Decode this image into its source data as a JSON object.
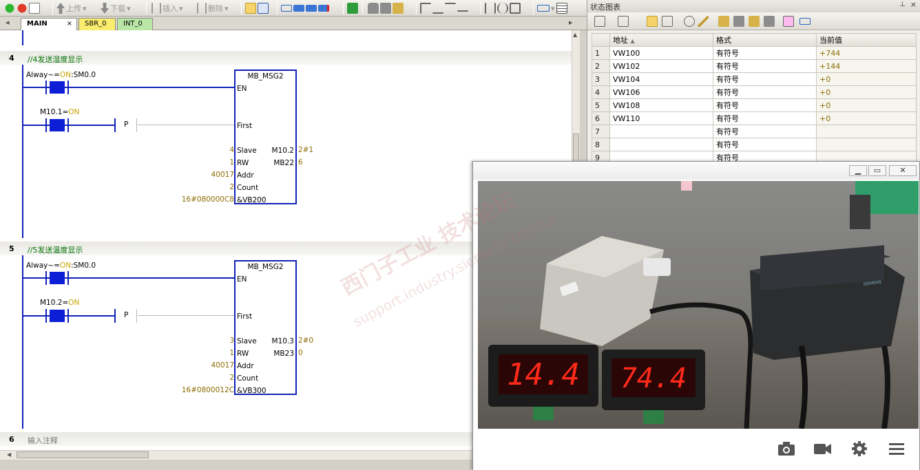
{
  "toolbar": {
    "upload_label": "上传",
    "download_label": "下载",
    "insert_label": "插入",
    "delete_label": "删除"
  },
  "tabs": [
    {
      "label": "MAIN"
    },
    {
      "label": "SBR_0"
    },
    {
      "label": "INT_0"
    }
  ],
  "networks": [
    {
      "number": "4",
      "comment": "//4发送湿度显示",
      "contact1": {
        "name": "Alway~",
        "state": "ON",
        "addr": ":SM0.0"
      },
      "contact2": {
        "name": "M10.1",
        "state": "ON"
      },
      "edge": "P",
      "block": {
        "title": "MB_MSG2",
        "pins_left": [
          "EN",
          "First",
          "Slave",
          "RW",
          "Addr",
          "Count",
          "&VB200"
        ],
        "inputs": [
          "4",
          "1",
          "40017",
          "2",
          "16#080000C8"
        ],
        "outputs": [
          {
            "name": "M10.2",
            "value": "2#1"
          },
          {
            "name": "MB22",
            "value": "6"
          }
        ]
      }
    },
    {
      "number": "5",
      "comment": "//5发送温度显示",
      "contact1": {
        "name": "Alway~",
        "state": "ON",
        "addr": ":SM0.0"
      },
      "contact2": {
        "name": "M10.2",
        "state": "ON"
      },
      "edge": "P",
      "block": {
        "title": "MB_MSG2",
        "pins_left": [
          "EN",
          "First",
          "Slave",
          "RW",
          "Addr",
          "Count",
          "&VB300"
        ],
        "inputs": [
          "3",
          "1",
          "40017",
          "2",
          "16#0800012C"
        ],
        "outputs": [
          {
            "name": "M10.3",
            "value": "2#0"
          },
          {
            "name": "MB23",
            "value": "0"
          }
        ]
      }
    },
    {
      "number": "6",
      "comment": "输入注释"
    }
  ],
  "status_chart": {
    "title": "状态图表",
    "headers": [
      "地址",
      "格式",
      "当前值"
    ],
    "rows": [
      {
        "n": "1",
        "addr": "VW100",
        "fmt": "有符号",
        "cur": "+744"
      },
      {
        "n": "2",
        "addr": "VW102",
        "fmt": "有符号",
        "cur": "+144"
      },
      {
        "n": "3",
        "addr": "VW104",
        "fmt": "有符号",
        "cur": "+0"
      },
      {
        "n": "4",
        "addr": "VW106",
        "fmt": "有符号",
        "cur": "+0"
      },
      {
        "n": "5",
        "addr": "VW108",
        "fmt": "有符号",
        "cur": "+0"
      },
      {
        "n": "6",
        "addr": "VW110",
        "fmt": "有符号",
        "cur": "+0"
      },
      {
        "n": "7",
        "addr": "",
        "fmt": "有符号",
        "cur": ""
      },
      {
        "n": "8",
        "addr": "",
        "fmt": "有符号",
        "cur": ""
      },
      {
        "n": "9",
        "addr": "",
        "fmt": "有符号",
        "cur": ""
      }
    ]
  },
  "video": {
    "display_left": "14.4",
    "display_right": "74.4",
    "brand": "SIEMENS",
    "icons": [
      "camera-icon",
      "video-icon",
      "gear-icon",
      "menu-icon"
    ]
  },
  "watermark": {
    "line1": "西门子工业  技术论坛",
    "line2": "support.industry.siemens.com/cs"
  },
  "colors": {
    "wire": "#1020b8",
    "contact": "#0d1fd6",
    "on": "#c8a400",
    "value": "#8c6c00",
    "comment": "#007000",
    "led": "#ff2a1a"
  }
}
